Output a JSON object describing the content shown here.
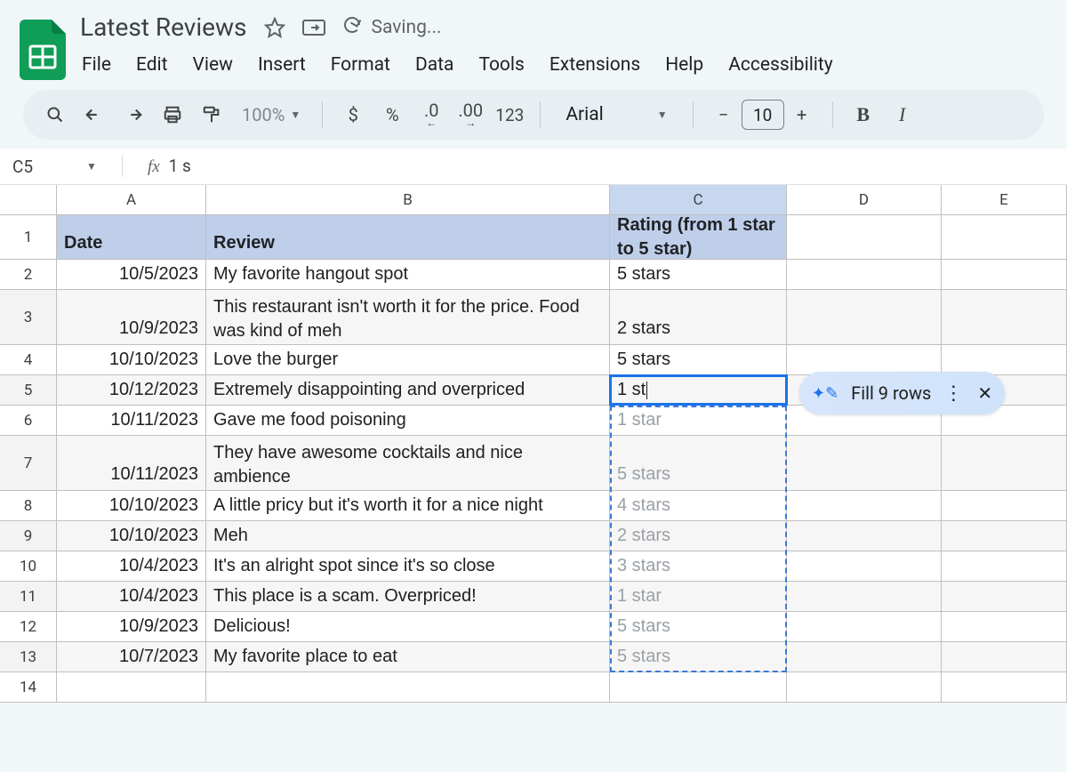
{
  "doc_title": "Latest Reviews",
  "saving_label": "Saving...",
  "menus": [
    "File",
    "Edit",
    "View",
    "Insert",
    "Format",
    "Data",
    "Tools",
    "Extensions",
    "Help",
    "Accessibility"
  ],
  "toolbar": {
    "zoom": "100%",
    "currency": "$",
    "percent": "%",
    "dec_dec": ".0",
    "inc_dec": ".00",
    "num123": "123",
    "font_name": "Arial",
    "font_size": "10",
    "bold": "B",
    "italic": "I"
  },
  "name_box": "C5",
  "fx_value": "1 s",
  "columns": [
    "A",
    "B",
    "C",
    "D",
    "E"
  ],
  "headers": {
    "A": "Date",
    "B": "Review",
    "C": "Rating (from 1 star to 5 star)"
  },
  "active_cell": {
    "ref": "C5",
    "typed": "1 st"
  },
  "fill_pill": {
    "label": "Fill 9 rows"
  },
  "rows": [
    {
      "n": 2,
      "date": "10/5/2023",
      "review": "My favorite hangout spot",
      "rating": "5 stars"
    },
    {
      "n": 3,
      "date": "10/9/2023",
      "review": "This restaurant isn't worth it for the price. Food was kind of meh",
      "rating": "2 stars"
    },
    {
      "n": 4,
      "date": "10/10/2023",
      "review": "Love the burger",
      "rating": "5 stars"
    },
    {
      "n": 5,
      "date": "10/12/2023",
      "review": "Extremely disappointing and overpriced",
      "rating": "1 st",
      "editing": true
    },
    {
      "n": 6,
      "date": "10/11/2023",
      "review": "Gave me food poisoning",
      "rating": "1 star",
      "ghost": true
    },
    {
      "n": 7,
      "date": "10/11/2023",
      "review": "They have awesome cocktails and nice ambience",
      "rating": "5 stars",
      "ghost": true
    },
    {
      "n": 8,
      "date": "10/10/2023",
      "review": "A little pricy but it's worth it for a nice night",
      "rating": "4 stars",
      "ghost": true
    },
    {
      "n": 9,
      "date": "10/10/2023",
      "review": "Meh",
      "rating": "2 stars",
      "ghost": true
    },
    {
      "n": 10,
      "date": "10/4/2023",
      "review": "It's an alright spot since it's so close",
      "rating": "3 stars",
      "ghost": true
    },
    {
      "n": 11,
      "date": "10/4/2023",
      "review": "This place is a scam. Overpriced!",
      "rating": "1 star",
      "ghost": true
    },
    {
      "n": 12,
      "date": "10/9/2023",
      "review": "Delicious!",
      "rating": "5 stars",
      "ghost": true
    },
    {
      "n": 13,
      "date": "10/7/2023",
      "review": "My favorite place to eat",
      "rating": "5 stars",
      "ghost": true
    },
    {
      "n": 14,
      "date": "",
      "review": "",
      "rating": ""
    }
  ]
}
